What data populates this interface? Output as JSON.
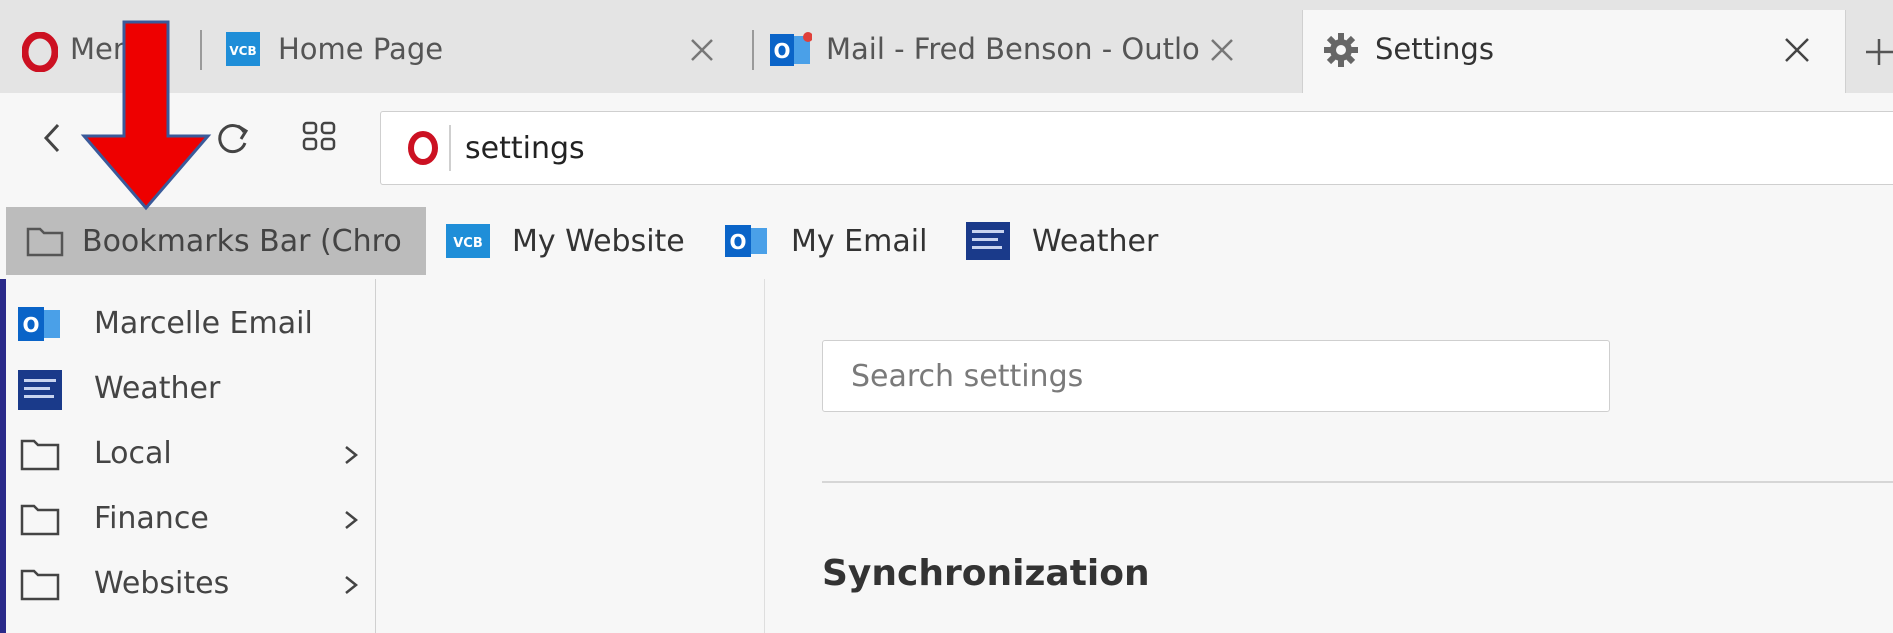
{
  "tabs": [
    {
      "label": "Menu",
      "icon": "opera-icon"
    },
    {
      "label": "Home Page",
      "icon": "vcb-icon"
    },
    {
      "label": "Mail - Fred Benson - Outlo",
      "icon": "outlook-icon"
    },
    {
      "label": "Settings",
      "icon": "gear-icon",
      "active": true
    }
  ],
  "address_bar": {
    "url": "settings"
  },
  "bookmarks_bar": {
    "folder_label": "Bookmarks Bar (Chro",
    "items": [
      {
        "label": "My Website",
        "icon": "vcb-icon"
      },
      {
        "label": "My Email",
        "icon": "outlook-icon"
      },
      {
        "label": "Weather",
        "icon": "weather-channel-icon"
      }
    ]
  },
  "bookmarks_dropdown": {
    "items": [
      {
        "label": "Marcelle Email",
        "icon": "outlook-icon"
      },
      {
        "label": "Weather",
        "icon": "weather-channel-icon"
      },
      {
        "label": "Local",
        "icon": "folder-icon",
        "submenu": true
      },
      {
        "label": "Finance",
        "icon": "folder-icon",
        "submenu": true
      },
      {
        "label": "Websites",
        "icon": "folder-icon",
        "submenu": true
      }
    ]
  },
  "settings": {
    "search_placeholder": "Search settings",
    "section_title": "Synchronization"
  },
  "icon_badges": {
    "vcb": "VCB",
    "outlook": "O"
  },
  "colors": {
    "opera_red": "#cc1122",
    "annotation_red": "#ee0000",
    "annotation_outline": "#3a5a9a",
    "vcb_blue": "#1f8ed8",
    "outlook_blue": "#0a64c8",
    "weather_navy": "#1a3a8a"
  }
}
